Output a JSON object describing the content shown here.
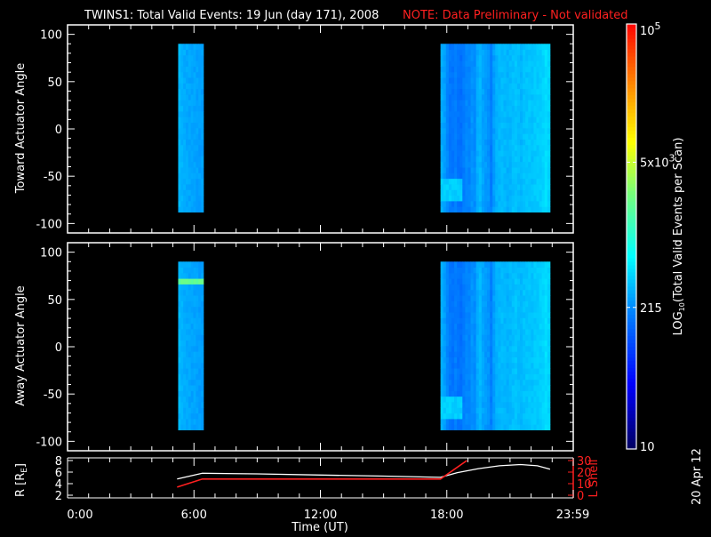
{
  "title": {
    "main": "TWINS1: Total Valid Events: 19 Jun (day 171), 2008",
    "note": "NOTE: Data Preliminary - Not validated",
    "note_color": "#ff2020"
  },
  "side_date": "20 Apr 12",
  "chart_data": {
    "type": "heatmap",
    "x": {
      "label": "Time (UT)",
      "range_hours": [
        0,
        24
      ],
      "tick_labels": [
        "0:00",
        "6:00",
        "12:00",
        "18:00",
        "23:59"
      ],
      "tick_hours": [
        0,
        6,
        12,
        18,
        23.98
      ]
    },
    "colorbar": {
      "label": "LOG10(Total Valid Events per Scan)",
      "label_main": "LOG",
      "label_sub": "10",
      "label_rest": "(Total Valid Events per Scan)",
      "scale": "log",
      "range": [
        10,
        100000
      ],
      "tick_values": [
        10,
        215,
        5000,
        100000
      ],
      "tick_labels": [
        "10",
        "215",
        "5x10",
        "10"
      ],
      "tick_sups": [
        "",
        "",
        "3",
        "5"
      ]
    },
    "panels": [
      {
        "name": "toward",
        "ylabel": "Toward Actuator Angle",
        "ylim": [
          -110,
          110
        ],
        "ytick_labels": [
          "100",
          "50",
          "0",
          "-50",
          "-100"
        ],
        "ytick_values": [
          100,
          50,
          0,
          -50,
          -100
        ],
        "angle_range": [
          -88,
          90
        ],
        "blocks": [
          {
            "time_range": [
              5.25,
              6.45
            ],
            "column_log10": [
              2.5,
              2.48,
              2.45,
              2.44,
              2.43,
              2.42,
              2.42,
              2.41,
              2.4,
              2.4
            ]
          },
          {
            "time_range": [
              17.7,
              22.9
            ],
            "column_log10": [
              2.45,
              2.4,
              2.3,
              2.22,
              2.2,
              2.25,
              2.2,
              2.18,
              2.24,
              2.3,
              2.28,
              2.35,
              2.32,
              2.45,
              2.5,
              2.42,
              2.38,
              2.35,
              2.25,
              2.4,
              2.48,
              2.5,
              2.52,
              2.5,
              2.48,
              2.5,
              2.53,
              2.55,
              2.52,
              2.5,
              2.54,
              2.55,
              2.56,
              2.55,
              2.57,
              2.58,
              2.6,
              2.62,
              2.66,
              2.62
            ]
          }
        ],
        "features": [
          {
            "block": 1,
            "angle_range": [
              -75,
              -50
            ],
            "columns": [
              0,
              8
            ],
            "log10": 2.6
          }
        ]
      },
      {
        "name": "away",
        "ylabel": "Away Actuator Angle",
        "ylim": [
          -110,
          110
        ],
        "ytick_labels": [
          "100",
          "50",
          "0",
          "-50",
          "-100"
        ],
        "ytick_values": [
          100,
          50,
          0,
          -50,
          -100
        ],
        "angle_range": [
          -88,
          90
        ],
        "blocks": [
          {
            "time_range": [
              5.25,
              6.45
            ],
            "column_log10": [
              2.5,
              2.48,
              2.45,
              2.44,
              2.43,
              2.42,
              2.42,
              2.41,
              2.4,
              2.4
            ]
          },
          {
            "time_range": [
              17.7,
              22.9
            ],
            "column_log10": [
              2.45,
              2.4,
              2.3,
              2.22,
              2.2,
              2.25,
              2.2,
              2.18,
              2.24,
              2.3,
              2.28,
              2.35,
              2.32,
              2.45,
              2.5,
              2.42,
              2.38,
              2.35,
              2.25,
              2.4,
              2.48,
              2.5,
              2.52,
              2.5,
              2.48,
              2.5,
              2.53,
              2.55,
              2.52,
              2.5,
              2.54,
              2.55,
              2.56,
              2.55,
              2.57,
              2.58,
              2.6,
              2.62,
              2.66,
              2.62
            ]
          }
        ],
        "features": [
          {
            "block": 0,
            "angle_range": [
              65,
              75
            ],
            "columns": [
              0,
              10
            ],
            "log10": 3.3
          },
          {
            "block": 1,
            "angle_range": [
              -75,
              -50
            ],
            "columns": [
              0,
              8
            ],
            "log10": 2.6
          }
        ]
      }
    ],
    "orbit": {
      "left_axis": {
        "label": "R [R",
        "label_sub": "E",
        "label_end": "]",
        "range": [
          2,
          8
        ],
        "tick_labels": [
          "8",
          "6",
          "4",
          "2"
        ],
        "tick_values": [
          8,
          6,
          4,
          2
        ]
      },
      "right_axis": {
        "label": "L Shell",
        "range": [
          0,
          30
        ],
        "tick_labels": [
          "30",
          "20",
          "10",
          "0"
        ],
        "tick_values": [
          30,
          20,
          10,
          0
        ],
        "color": "#ff2020"
      },
      "series": [
        {
          "name": "R",
          "color": "#ffffff",
          "x_hours": [
            5.2,
            5.8,
            6.4,
            9,
            12,
            15,
            17.7,
            18.5,
            19.5,
            20.5,
            21.5,
            22.3,
            22.9
          ],
          "y": [
            4.8,
            5.3,
            5.8,
            5.7,
            5.5,
            5.3,
            5.1,
            5.9,
            6.6,
            7.1,
            7.3,
            7.1,
            6.5
          ]
        },
        {
          "name": "L Shell",
          "color": "#ff2020",
          "x_hours": [
            5.2,
            6.4,
            17.7,
            18.95
          ],
          "y": [
            7,
            14,
            14,
            30
          ]
        }
      ]
    }
  }
}
